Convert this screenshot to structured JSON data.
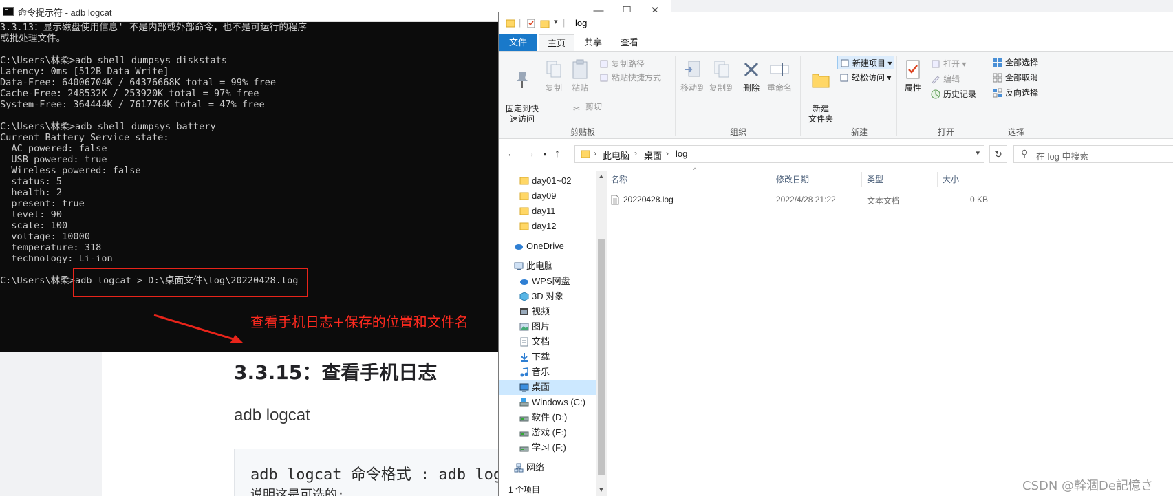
{
  "blog": {
    "heading": "3.3.15：查看手机日志",
    "paragraph": "adb logcat",
    "code_line1": "adb logcat 命令格式 : adb log",
    "code_line2": "说明这是可选的:"
  },
  "cmd": {
    "title": "命令提示符 - adb  logcat",
    "lines": [
      "3.3.13：显示磁盘使用信息' 不是内部或外部命令，也不是可运行的程序",
      "或批处理文件。",
      "",
      "C:\\Users\\林柔>adb shell dumpsys diskstats",
      "Latency: 0ms [512B Data Write]",
      "Data-Free: 64006704K / 64376668K total = 99% free",
      "Cache-Free: 248532K / 253920K total = 97% free",
      "System-Free: 364444K / 761776K total = 47% free",
      "",
      "C:\\Users\\林柔>adb shell dumpsys battery",
      "Current Battery Service state:",
      "  AC powered: false",
      "  USB powered: true",
      "  Wireless powered: false",
      "  status: 5",
      "  health: 2",
      "  present: true",
      "  level: 90",
      "  scale: 100",
      "  voltage: 10000",
      "  temperature: 318",
      "  technology: Li-ion",
      "",
      "C:\\Users\\林柔>adb logcat > D:\\桌面文件\\log\\20220428.log"
    ],
    "annotation": "查看手机日志+保存的位置和文件名"
  },
  "explorer": {
    "title": "log",
    "tabs": [
      "文件",
      "主页",
      "共享",
      "查看"
    ],
    "ribbon": {
      "pin": "固定到快\n速访问",
      "copy": "复制",
      "paste": "粘贴",
      "copy_path": "复制路径",
      "paste_shortcut": "粘贴快捷方式",
      "cut": "剪切",
      "clipboard": "剪贴板",
      "move_to": "移动到",
      "copy_to": "复制到",
      "delete": "删除",
      "rename": "重命名",
      "organize": "组织",
      "new_folder": "新建\n文件夹",
      "new_item": "新建项目",
      "easy_access": "轻松访问",
      "new": "新建",
      "properties": "属性",
      "open": "打开",
      "edit": "编辑",
      "history": "历史记录",
      "open_group": "打开",
      "select_all": "全部选择",
      "select_none": "全部取消",
      "invert": "反向选择",
      "select": "选择"
    },
    "breadcrumb": [
      "此电脑",
      "桌面",
      "log"
    ],
    "search_placeholder": "在 log 中搜索",
    "sidebar": [
      "day01~02",
      "day09",
      "day11",
      "day12",
      "OneDrive",
      "此电脑",
      "WPS网盘",
      "3D 对象",
      "视频",
      "图片",
      "文档",
      "下载",
      "音乐",
      "桌面",
      "Windows (C:)",
      "软件 (D:)",
      "游戏 (E:)",
      "学习 (F:)",
      "网络"
    ],
    "columns": [
      "名称",
      "修改日期",
      "类型",
      "大小"
    ],
    "files": [
      {
        "name": "20220428.log",
        "date": "2022/4/28 21:22",
        "type": "文本文档",
        "size": "0 KB"
      }
    ],
    "status": "1 个项目"
  },
  "watermark": "CSDN @幹涸De記憶さ",
  "colors": {
    "accent": "#1979ca",
    "annotation_red": "#e8241a",
    "cmd_bg": "#0c0c0c",
    "cmd_text": "#cccccc",
    "folder": "#ffd766"
  }
}
